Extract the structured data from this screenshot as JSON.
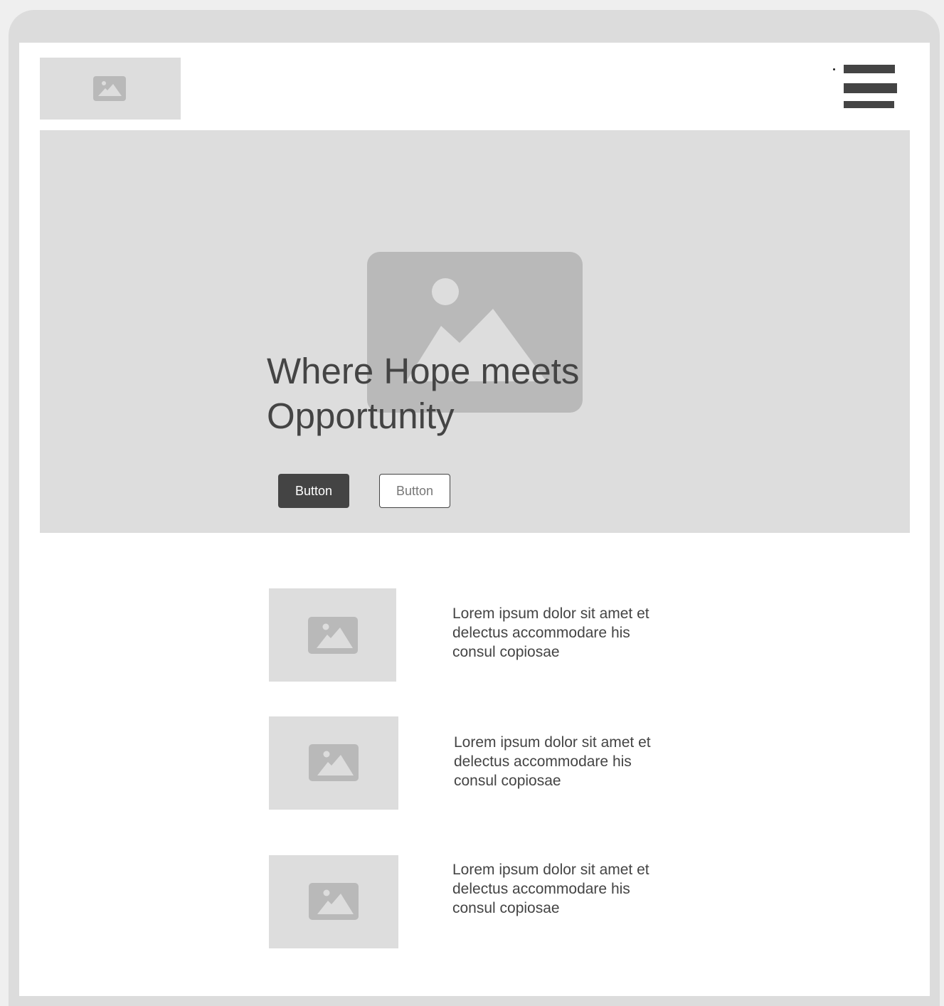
{
  "icons": {
    "logo": "image-placeholder-icon",
    "menu": "hamburger-menu-icon",
    "hero": "image-placeholder-icon",
    "feature": "image-placeholder-icon"
  },
  "colors": {
    "frame": "#dcdcdc",
    "placeholder": "#dddddd",
    "placeholder_icon": "#b9b9b9",
    "text": "#444444",
    "primary_button": "#444444"
  },
  "hero": {
    "title": "Where Hope meets Opportunity",
    "primary_button": "Button",
    "secondary_button": "Button"
  },
  "features": [
    {
      "text": "Lorem ipsum dolor sit amet et delectus accommodare his consul copiosae"
    },
    {
      "text": "Lorem ipsum dolor sit amet et delectus accommodare his consul copiosae"
    },
    {
      "text": "Lorem ipsum dolor sit amet et delectus accommodare his consul copiosae"
    }
  ]
}
